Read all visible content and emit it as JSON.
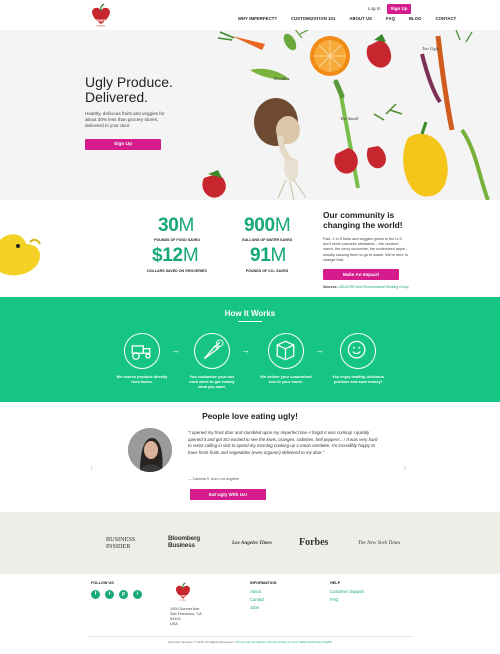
{
  "header": {
    "brand": "IMPERFECT",
    "brand_sub": "produce",
    "nav": [
      "WHY IMPERFECT?",
      "CUSTOMIZATION 101",
      "ABOUT US",
      "FAQ",
      "BLOG",
      "CONTACT"
    ],
    "login": "Log In",
    "signup": "Sign Up"
  },
  "hero": {
    "title": "Ugly Produce. Delivered.",
    "subtitle": "Healthy, delicious fruits and veggies for about 30% less than grocery stores, delivered to your door.",
    "button": "Sign Up",
    "doodles": [
      "Doodles",
      "Too Small",
      "Too Ugly"
    ]
  },
  "stats": {
    "items": [
      {
        "number": "30",
        "unit": "M",
        "label": "POUNDS OF FOOD SAVED"
      },
      {
        "number": "900",
        "unit": "M",
        "label": "GALLONS OF WATER SAVED"
      },
      {
        "number": "$12",
        "unit": "M",
        "label": "DOLLARS SAVED ON GROCERIES"
      },
      {
        "number": "91",
        "unit": "M",
        "label": "POUNDS OF CO₂ SAVED"
      }
    ],
    "community_title": "Our community is changing the world!",
    "community_text": "Fact: 1 in 5 fruits and veggies grown in the U.S. don't meet cosmetic standards – the crooked carrot, the curvy cucumber, the undersized apple – usually causing them to go to waste. We're here to change that.",
    "button": "Make An Impact!",
    "sources_label": "Sources:",
    "sources_links": "USDA ERS and Environmental Working Group"
  },
  "how": {
    "title": "How It Works",
    "steps": [
      {
        "icon": "tractor-icon",
        "text": "We source produce directly from farms."
      },
      {
        "icon": "carrot-icon",
        "text": "You customize your box each week to get exactly what you want."
      },
      {
        "icon": "box-icon",
        "text": "We deliver your customized box to your home."
      },
      {
        "icon": "smiley-icon",
        "text": "You enjoy healthy, delicious produce and save money!"
      }
    ]
  },
  "testimonial": {
    "title": "People love eating ugly!",
    "quote": "“I opened my front door and stumbled upon my Imperfect box–I forgot it was coming! I quickly opened it and got SO excited to see the kiwis, oranges, radishes, bell peppers…! It was very hard to resist calling in sick to spend my morning cooking up a mean omelette. I'm incredibly happy to have fresh fruits and vegetables (even organic!) delivered to my door.”",
    "author": "— Camelia S. from Los Angeles",
    "button": "Eat Ugly With Us!"
  },
  "press": [
    "BUSINESS INSIDER",
    "Bloomberg Business",
    "Los Angeles Times",
    "Forbes",
    "The New York Times"
  ],
  "footer": {
    "follow_us": "FOLLOW US",
    "social": [
      "f",
      "t",
      "p",
      "i"
    ],
    "address": "1000 Donner Ave.\nSan Francisco, CA\n94124\nUSA",
    "information": "INFORMATION",
    "info_links": [
      "About",
      "Contact",
      "Jobs"
    ],
    "help": "HELP",
    "help_links": [
      "Customer Support",
      "FAQ"
    ],
    "copyright_pre": "Imperfect produce © 2016. All Rights Reserved. |",
    "copyright_links": "Terms and Conditions | Privacy Policy & Your California Privacy Rights"
  },
  "colors": {
    "brand_pink": "#d41c8c",
    "brand_green": "#16c584",
    "accent_green": "#17a878"
  }
}
